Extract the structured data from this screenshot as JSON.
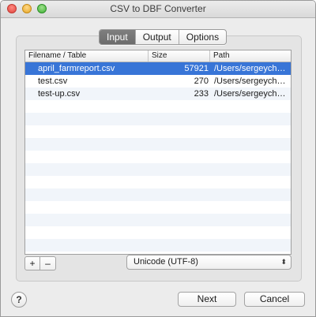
{
  "window": {
    "title": "CSV to DBF Converter"
  },
  "tabs": [
    {
      "label": "Input",
      "active": true
    },
    {
      "label": "Output",
      "active": false
    },
    {
      "label": "Options",
      "active": false
    }
  ],
  "table": {
    "columns": [
      "Filename / Table",
      "Size",
      "Path"
    ],
    "rows": [
      {
        "filename": "april_farmreport.csv",
        "size": "57921",
        "path": "/Users/sergeyche…",
        "selected": true
      },
      {
        "filename": "test.csv",
        "size": "270",
        "path": "/Users/sergeyche…",
        "selected": false
      },
      {
        "filename": "test-up.csv",
        "size": "233",
        "path": "/Users/sergeyche…",
        "selected": false
      }
    ]
  },
  "controls": {
    "add_label": "+",
    "remove_label": "–",
    "encoding_value": "Unicode (UTF-8)",
    "encoding_arrow": "⬍"
  },
  "footer": {
    "help_label": "?",
    "next_label": "Next",
    "cancel_label": "Cancel"
  },
  "colors": {
    "selection": "#3875d7",
    "stripe": "#f1f5fa",
    "active_tab": "#6c6c6c"
  }
}
